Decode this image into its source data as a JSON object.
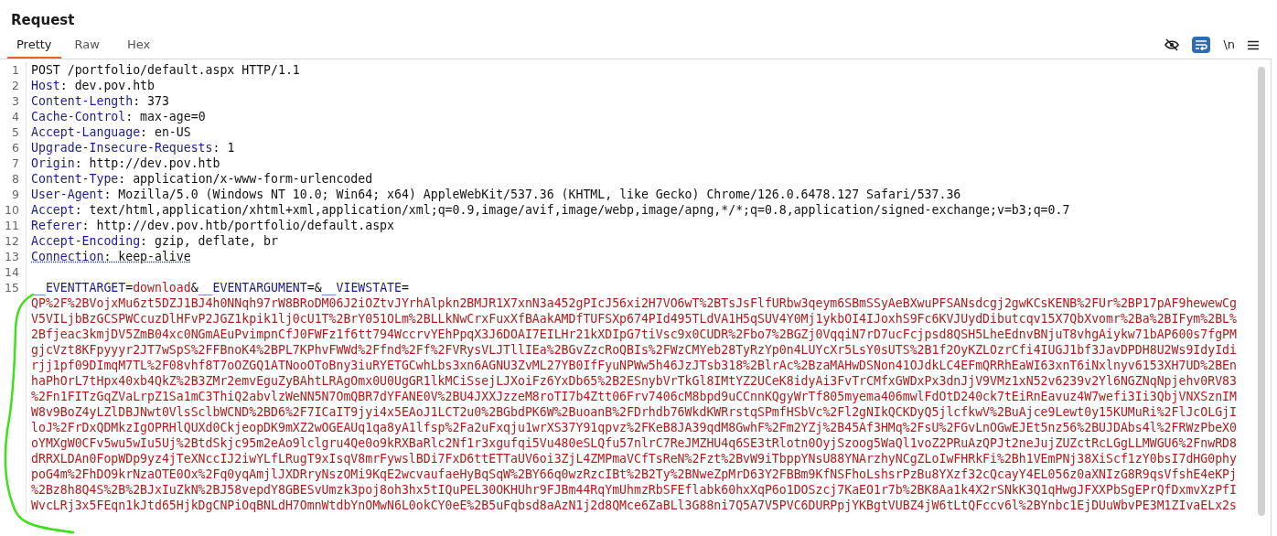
{
  "panel_title": "Request",
  "tabs": [
    {
      "label": "Pretty",
      "selected": true
    },
    {
      "label": "Raw",
      "selected": false
    },
    {
      "label": "Hex",
      "selected": false
    }
  ],
  "toolbar": [
    {
      "kind": "hide",
      "on": false
    },
    {
      "kind": "wrap",
      "on": true
    },
    {
      "kind": "newline",
      "label": "\\n",
      "on": false
    },
    {
      "kind": "menu"
    }
  ],
  "lines": [
    {
      "number": "1",
      "kind": "request_line",
      "text": "POST /portfolio/default.aspx HTTP/1.1"
    },
    {
      "number": "2",
      "kind": "header",
      "name": "Host",
      "separator": ":",
      "value": "dev.pov.htb",
      "underlined": false
    },
    {
      "number": "3",
      "kind": "header",
      "name": "Content-Length",
      "separator": ":",
      "value": "373",
      "underlined": false
    },
    {
      "number": "4",
      "kind": "header",
      "name": "Cache-Control",
      "separator": ":",
      "value": "max-age=0",
      "underlined": false
    },
    {
      "number": "5",
      "kind": "header",
      "name": "Accept-Language",
      "separator": ":",
      "value": "en-US",
      "underlined": false
    },
    {
      "number": "6",
      "kind": "header",
      "name": "Upgrade-Insecure-Requests",
      "separator": ":",
      "value": "1",
      "underlined": false
    },
    {
      "number": "7",
      "kind": "header",
      "name": "Origin",
      "separator": ":",
      "value": "http://dev.pov.htb",
      "underlined": false
    },
    {
      "number": "8",
      "kind": "header",
      "name": "Content-Type",
      "separator": ":",
      "value": "application/x-www-form-urlencoded",
      "underlined": false
    },
    {
      "number": "9",
      "kind": "header",
      "name": "User-Agent",
      "separator": ":",
      "value": "Mozilla/5.0 (Windows NT 10.0; Win64; x64) AppleWebKit/537.36 (KHTML, like Gecko) Chrome/126.0.6478.127 Safari/537.36",
      "underlined": false
    },
    {
      "number": "10",
      "kind": "header",
      "name": "Accept",
      "separator": ":",
      "value": "text/html,application/xhtml+xml,application/xml;q=0.9,image/avif,image/webp,image/apng,*/*;q=0.8,application/signed-exchange;v=b3;q=0.7",
      "underlined": false
    },
    {
      "number": "11",
      "kind": "header",
      "name": "Referer",
      "separator": ":",
      "value": "http://dev.pov.htb/portfolio/default.aspx",
      "underlined": false
    },
    {
      "number": "12",
      "kind": "header",
      "name": "Accept-Encoding",
      "separator": ":",
      "value": "gzip, deflate, br",
      "underlined": false
    },
    {
      "number": "13",
      "kind": "header",
      "name": "Connection",
      "separator": ":",
      "value": "keep-alive",
      "underlined": true
    },
    {
      "number": "14",
      "kind": "blank"
    },
    {
      "number": "15",
      "kind": "body",
      "segments": [
        {
          "kind": "name",
          "text": "__EVENTTARGET"
        },
        {
          "kind": "punct",
          "text": "="
        },
        {
          "kind": "value",
          "text": "download"
        },
        {
          "kind": "punct",
          "text": "&"
        },
        {
          "kind": "name",
          "text": "__EVENTARGUMENT"
        },
        {
          "kind": "punct",
          "text": "=&"
        },
        {
          "kind": "name",
          "text": "__VIEWSTATE"
        },
        {
          "kind": "punct",
          "text": "="
        }
      ],
      "continuation": [
        "QP%2F%2BVojxMu6zt5DZJ1BJ4h0NNqh97rW8BRoDM06J2iOZtvJYrhAlpkn2BMJR1X7xnN3a452gPIcJ56xi2H7VO6wT%2BTsJsFlfURbw3qeym6SBmSSyAeBXwuPFSANsdcgj2gwKCsKENB%2FUr%2BP17pAF9hewewCg",
        "V5VILjbBzGCSPWCcuzDlHFvP2JGZ1kpik1lj0cU1T%2BrY051OLm%2BLLkNwCrxFuxXfBAakAMDfTUFSXp674PId495TLdVA1H5qSUV4Y0Mj1ykbOI4IJoxhS9Fc6KVJUydDibutcqv15X7QbXvomr%2Ba%2BIFym%2BL%",
        "2Bfjeac3kmjDV5ZmB04xc0NGmAEuPvimpnCfJ0FWFz1f6tt794WccrvYEhPpqX3J6DOAI7EILHr21kXDIpG7tiVsc9x0CUDR%2Fbo7%2BGZj0VqqiN7rD7ucFcjpsd8QSH5LheEdnvBNjuT8vhgAiykw71bAP600s7fgPM",
        "gjcVzt8KFpyyyr2JT7wSpS%2FFBnoK4%2BPL7KPhvFWWd%2Ffnd%2Ff%2FVRysVLJTllIEa%2BGvZzcRoQBIs%2FWzCMYeb28TyRzYp0n4LUYcXr5LsY0sUTS%2B1f2OyKZLOzrCfi4IUGJ1bf3JavDPDH8U2Ws9IdyIdi",
        "rjj1pf09DImqM7TL%2F08vhf8T7oOZGQ1ATNooOToBny3iuRYETGCwhLbs3xn6AGNU3ZvML27YB0IfFyuNPWw5h46JzJTsb318%2BlrAc%2BzaMAHwDSNon41OJdkLC4EFmQRRhEaWI63xnT6iNxlnyv6153XH7UD%2BEn",
        "haPhOrL7tHpx40xb4QkZ%2B3ZMr2emvEguZyBAhtLRAgOmx0U0UgGR1lkMCiSsejLJXoiFz6YxDb65%2B2ESnybVrTkGl8IMtYZ2UCeK8idyAi3FvTrCMfxGWDxPx3dnJjV9VMz1xN52v6239v2Yl6NGZNqNpjehv0RV83",
        "%2Fn1FITzGqZVaLrpZ1Sa1mC3ThiQ2abvlzWeNN5N7OmQBR7dYFANE0V%2BU4JXXJzzeM8roTI7b4Ztt06Frv7406cM8bpd9uCCnnKQgyWrTf805myema406mwlFdOtD240ck7tEiRnEavuz4W7wefi3Ii3QbjVNXSznIM",
        "W8v9BoZ4yLZlDBJNwt0VlsSclbWCND%2BD6%2F7ICaIT9jyi4x5EAoJ1LCT2u0%2BGbdPK6W%2BuoanB%2FDrhdb76WkdKWRrstqSPmfHSbVc%2Fl2gNIkQCKDyQ5jlcfkwV%2BuAjce9Lewt0y15KUMuRi%2FlJcOLGjI",
        "loJ%2FrDxQDMkzIgOPRHlQUXd0CkjeopDK9mXZ2wOGEAUq1qa8yA1lfsp%2Fa2uFxqju1wrXS37Y91qpvz%2FKeB8JA39qdM8GwhF%2Fm2YZj%2B45Af3HMq%2FsU%2FGvLnOGwEJEt5nz56%2BUJDAbs4l%2FRWzPbeX0",
        "oYMXgW0CFv5wu5wIu5Uj%2BtdSkjc95m2eAo9lclgru4Qe0o9kRXBaRlc2Nf1r3xgufqi5Vu480eSLQfu57nlrC7ReJMZHU4q6SE3tRlotn0OyjSzoog5WaQl1voZ2PRuAzQPJt2neJujZUZctRcLGgLLMWGU6%2FnwRD8",
        "dRRXLDAn0FopWDp9yz4jTeXNccIJ2iwYLfLRugT9xIsqV8mrFywslBDi7FxD6ttETTaUV6oi3ZjL4ZMPmaVCfTsReN%2Fzt%2BvW9iTbppYNsU88YNArzhyNCgZLoIwFHRkFi%2Bh1VEmPNj38XiScf1zY0bsI7dHG0phy",
        "poG4m%2FhDO9krNzaOTE0Ox%2Fq0yqAmjlJXDRryNszOMi9KqE2wcvaufaeHyBqSqW%2BY66q0wzRzcIBt%2B2Ty%2BNweZpMrD63Y2FBBm9KfNSFhoLshsrPzBu8YXzf32cQcayY4EL056z0aXNIzG8R9qsVfshE4eKPj",
        "%2Bz8h8Q4S%2B%2BJxIuZkN%2BJ58vepdY8GBESvUmzk3poj8oh3hx5tIQuPEL30OKHUhr9FJBm44RqYmUhmzRbSFEflabk60hxXqP6o1DOSzcj7KaEO1r7b%2BK8Aa1k4X2rSNkK3Q1qHwgJFXXPbSgEPrQfDxmvXzPfI",
        "WvcLRj3x5FEqn1kJtd65HjkDgCNPiOqBNLdH7OmnWtdbYnOMwN6L0okCY0eE%2B5uFqbsd8aAzN1j2d8QMce6ZaBLl3G88ni7Q5A7V5PVC6DURPpjYKBgtVUBZ4jW6tLtQFccv6l%2BYnbc1EjDUuWbvPE3M1ZIvaELx2s"
      ]
    }
  ]
}
